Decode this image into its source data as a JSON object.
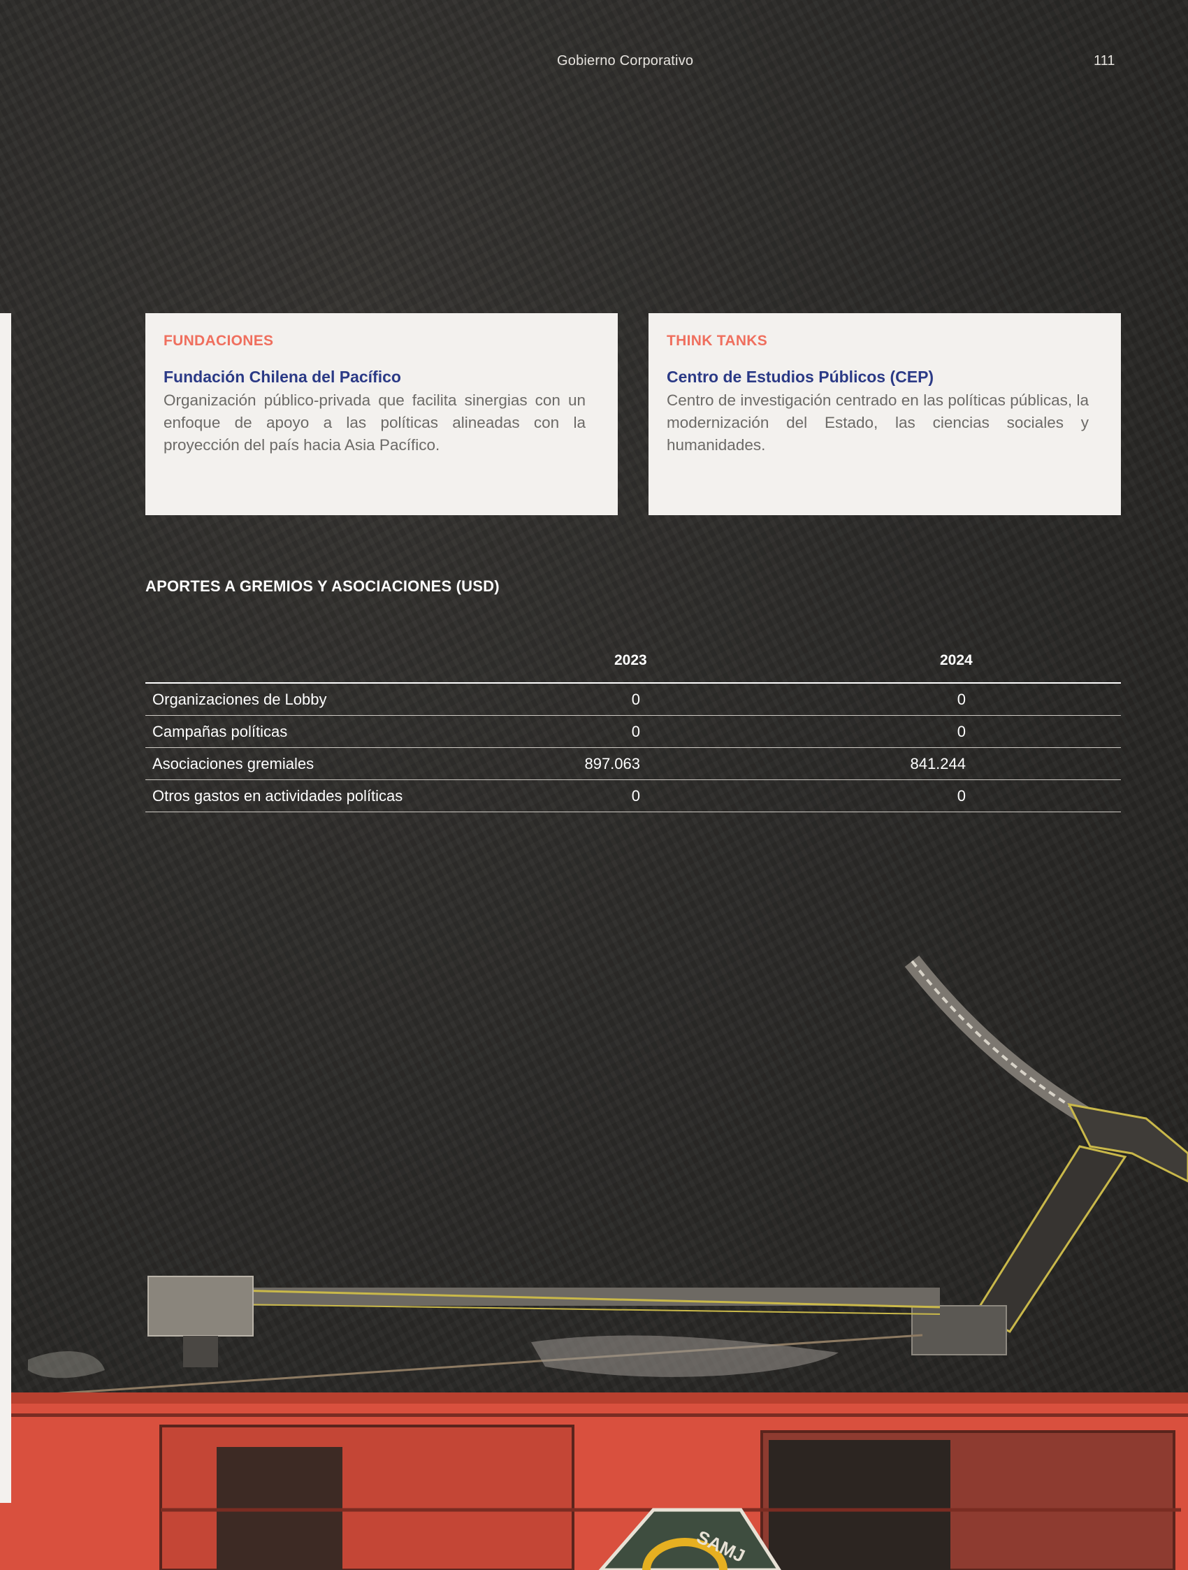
{
  "header": {
    "section_title": "Gobierno Corporativo",
    "page_number": "111"
  },
  "cards": [
    {
      "category": "FUNDACIONES",
      "organization": "Fundación Chilena del Pacífico",
      "description": "Organización público-privada que facilita sinergias con un enfoque de apoyo a las políticas alineadas con la proyección del país hacia Asia Pacífico."
    },
    {
      "category": "THINK TANKS",
      "organization": "Centro de Estudios Públicos (CEP)",
      "description": "Centro de investigación centrado en las políticas públicas, la modernización del Estado, las ciencias sociales y humanidades."
    }
  ],
  "table": {
    "title": "APORTES A GREMIOS Y ASOCIACIONES (USD)",
    "columns": [
      "",
      "2023",
      "2024"
    ],
    "rows": [
      {
        "label": "Organizaciones de Lobby",
        "v2023": "0",
        "v2024": "0"
      },
      {
        "label": "Campañas políticas",
        "v2023": "0",
        "v2024": "0"
      },
      {
        "label": "Asociaciones gremiales",
        "v2023": "897.063",
        "v2024": "841.244"
      },
      {
        "label": "Otros gastos en actividades políticas",
        "v2023": "0",
        "v2024": "0"
      }
    ]
  },
  "photo": {
    "ship_hull_text": "SAMJ"
  },
  "colors": {
    "accent_orange": "#ef6f5e",
    "navy": "#2b3a86",
    "card_bg": "#f3f1ee",
    "ship_red": "#d9503e"
  }
}
